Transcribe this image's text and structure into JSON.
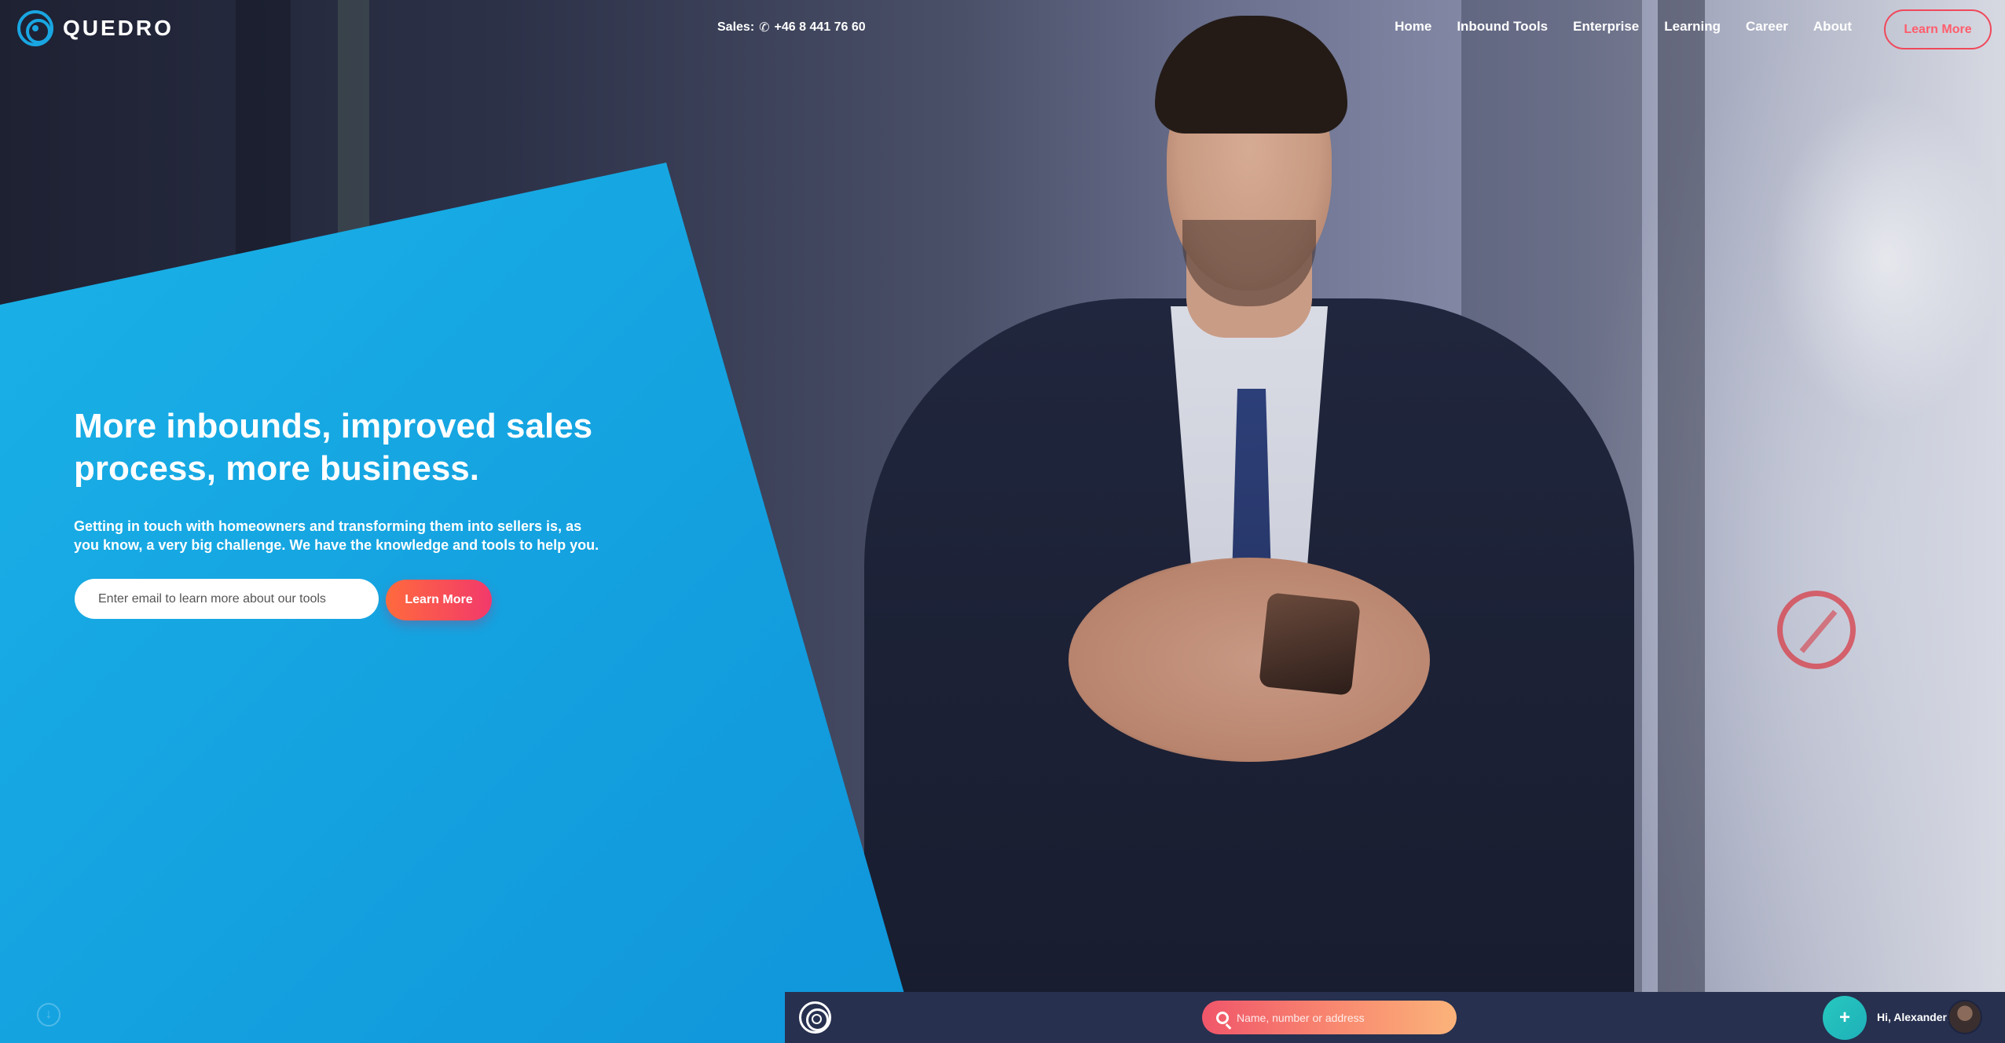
{
  "header": {
    "logo_text": "QUEDRO",
    "sales_label": "Sales:",
    "sales_phone": "+46 8 441 76 60",
    "nav": [
      {
        "label": "Home"
      },
      {
        "label": "Inbound Tools"
      },
      {
        "label": "Enterprise"
      },
      {
        "label": "Learning"
      },
      {
        "label": "Career"
      },
      {
        "label": "About"
      }
    ],
    "cta_label": "Learn More"
  },
  "hero": {
    "title": "More inbounds, improved sales process, more business.",
    "subtitle": "Getting in touch with homeowners and transforming them into sellers is, as you know, a very big challenge. We have the knowledge and tools to help you.",
    "email_placeholder": "Enter email to learn more about our tools",
    "email_value": "",
    "button_label": "Learn More"
  },
  "app_bar": {
    "search_placeholder": "Name, number or address",
    "add_label": "+",
    "greeting": "Hi, Alexander!"
  },
  "icons": {
    "logo": "quedro-logo-icon",
    "phone": "phone-icon",
    "search": "search-icon",
    "scroll": "scroll-down-icon",
    "add": "plus-icon",
    "avatar": "user-avatar"
  },
  "colors": {
    "panel_blue": "#1199dc",
    "accent_red": "#f0485a",
    "cta_gradient_start": "#ff6a3d",
    "cta_gradient_end": "#f2396b",
    "app_bar": "#27304f",
    "teal": "#27c8c0"
  }
}
